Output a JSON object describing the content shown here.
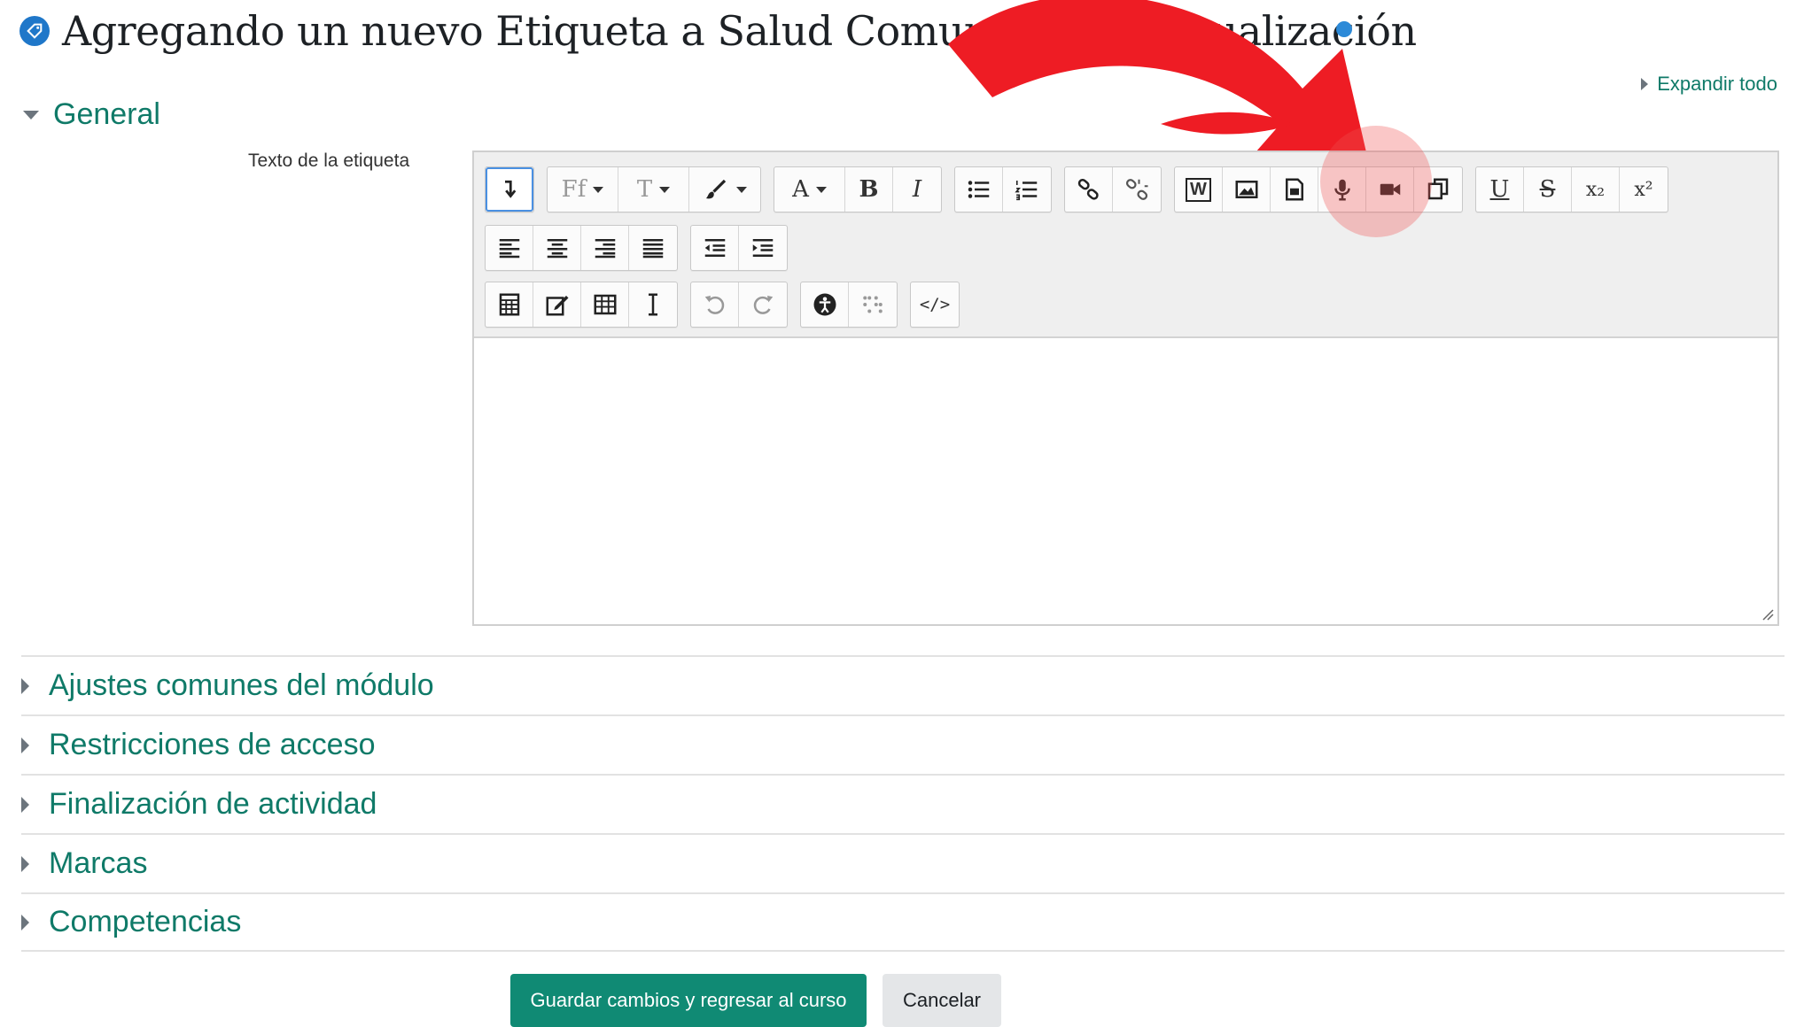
{
  "header": {
    "title": "Agregando un nuevo Etiqueta a Salud Comunitaria - Virtualización"
  },
  "expand_all": {
    "label": "Expandir todo"
  },
  "general": {
    "title": "General",
    "field_label": "Texto de la etiqueta"
  },
  "toolbar": {
    "font_family_label": "Ff",
    "font_size_label": "T",
    "font_color_label": "A",
    "bold_label": "B",
    "italic_label": "I",
    "underline_label": "U",
    "strike_label": "S",
    "subscript_label": "x₂",
    "superscript_label": "x²",
    "html_label": "</>",
    "word_label": "W"
  },
  "sections": [
    {
      "title": "Ajustes comunes del módulo"
    },
    {
      "title": "Restricciones de acceso"
    },
    {
      "title": "Finalización de actividad"
    },
    {
      "title": "Marcas"
    },
    {
      "title": "Competencias"
    }
  ],
  "actions": {
    "save_label": "Guardar cambios y regresar al curso",
    "cancel_label": "Cancelar"
  },
  "colors": {
    "accent": "#0f7a68",
    "primary_button": "#108a74",
    "annotation": "#ee1c24"
  }
}
